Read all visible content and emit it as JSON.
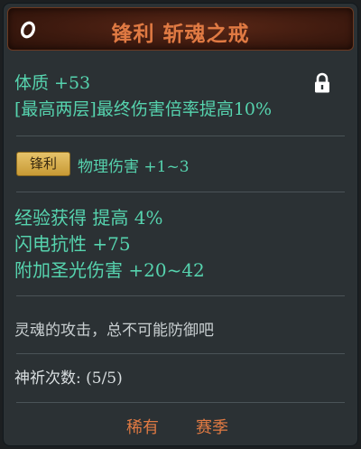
{
  "header": {
    "title": "锋利 斩魂之戒",
    "colors": {
      "title": "#e07a43",
      "bg": "#4a1f12"
    }
  },
  "icons": {
    "item": "ring-icon",
    "lock": "lock-icon"
  },
  "stats": {
    "vitality": "体质 +53",
    "passive": "[最高两层]最终伤害倍率提高10%"
  },
  "affix": {
    "badge": "锋利",
    "text": "物理伤害 +1~3"
  },
  "bonuses": [
    "经验获得 提高 4%",
    "闪电抗性 +75",
    "附加圣光伤害 +20~42"
  ],
  "flavor": "灵魂的攻击，总不可能防御吧",
  "prayer": "神祈次数: (5/5)",
  "footer": {
    "rarity": "稀有",
    "season": "赛季"
  },
  "palette": {
    "stat_text": "#56d3ae",
    "accent": "#e07a43",
    "panel": "#2b3134"
  }
}
